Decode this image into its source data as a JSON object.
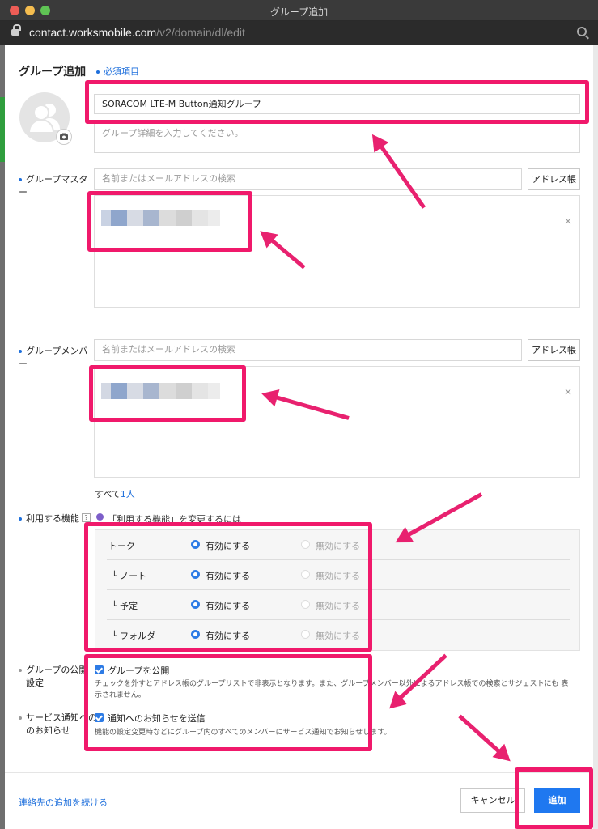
{
  "window": {
    "title": "グループ追加"
  },
  "browser": {
    "url_host": "contact.worksmobile.com",
    "url_path": "/v2/domain/dl/edit"
  },
  "header": {
    "title": "グループ追加",
    "required_note": "必須項目"
  },
  "group": {
    "name_value": "SORACOM LTE-M Button通知グループ",
    "desc_placeholder": "グループ詳細を入力してください。"
  },
  "master": {
    "label": "グループマスター",
    "search_placeholder": "名前またはメールアドレスの検索",
    "address_book_button": "アドレス帳",
    "remove_icon": "×"
  },
  "member": {
    "label": "グループメンバー",
    "search_placeholder": "名前またはメールアドレスの検索",
    "address_book_button": "アドレス帳",
    "remove_icon": "×",
    "total_prefix": "すべて",
    "total_count": "1人"
  },
  "features": {
    "label": "利用する機能",
    "help_icon": "?",
    "change_link": "「利用する機能」を変更するには",
    "enable_label": "有効にする",
    "disable_label": "無効にする",
    "rows": [
      {
        "name": "トーク",
        "enabled": true
      },
      {
        "name": "└  ノート",
        "enabled": true
      },
      {
        "name": "└  予定",
        "enabled": true
      },
      {
        "name": "└  フォルダ",
        "enabled": true
      }
    ]
  },
  "public": {
    "label_1": "グループの公開",
    "label_2": "設定",
    "checkbox_label": "グループを公開",
    "checked": true,
    "description_1": "チェックを外すとアドレス帳のグループリストで非表示となります。また、グループメンバー以外によるアドレス帳での検索とサジェストにも 表",
    "description_2": "示されません。"
  },
  "notice": {
    "label_1": "サービス通知への",
    "label_2": "のお知らせ",
    "checkbox_label": "通知へのお知らせを送信",
    "checked": true,
    "description": "機能の設定変更時などにグループ内のすべてのメンバーにサービス通知でお知らせします。"
  },
  "footer": {
    "continue_link": "連絡先の追加を続ける",
    "cancel_button": "キャンセル",
    "add_button": "追加"
  },
  "colors": {
    "accent": "#1e6fdc",
    "highlight": "#f0196b",
    "primary_button": "#1f78f0"
  }
}
